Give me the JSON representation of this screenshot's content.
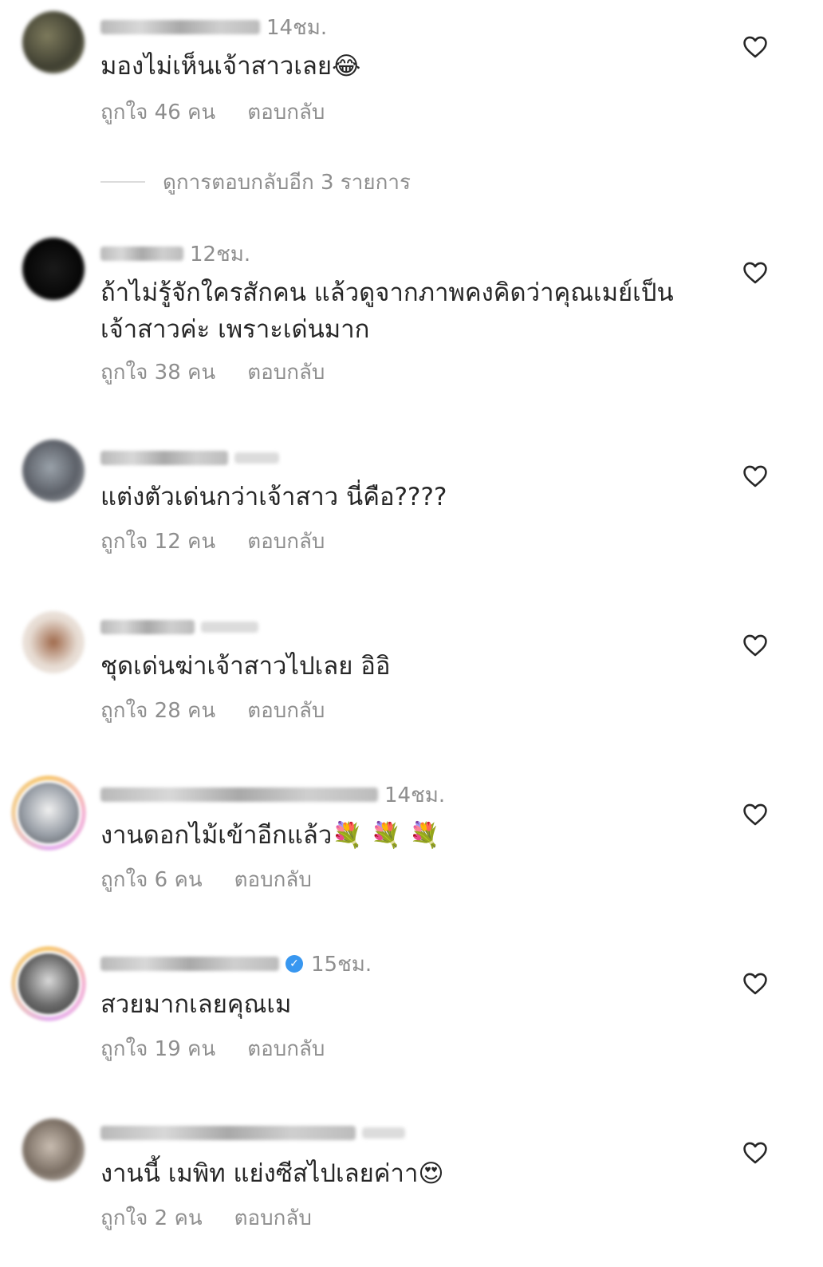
{
  "comments": [
    {
      "time": "14ชม.",
      "text": "มองไม่เห็นเจ้าสาวเลย😂",
      "likes": "ถูกใจ 46 คน",
      "reply": "ตอบกลับ",
      "avatar_color": "#5a5a48"
    },
    {
      "time": "12ชม.",
      "text": "ถ้าไม่รู้จักใครสักคน แล้วดูจากภาพคงคิดว่าคุณเมย์เป็น เจ้าสาวค่ะ เพราะเด่นมาก",
      "likes": "ถูกใจ 38 คน",
      "reply": "ตอบกลับ",
      "avatar_color": "#0a0a0a"
    },
    {
      "time": "",
      "text": "แต่งตัวเด่นกว่าเจ้าสาว นี่คือ????",
      "likes": "ถูกใจ 12 คน",
      "reply": "ตอบกลับ",
      "avatar_color": "#7b8086"
    },
    {
      "time": "",
      "text": "ชุดเด่นฆ่าเจ้าสาวไปเลย อิอิ",
      "likes": "ถูกใจ 28 คน",
      "reply": "ตอบกลับ",
      "avatar_color": "#c9b3a3"
    },
    {
      "time": "14ชม.",
      "text": "งานดอกไม้เข้าอีกแล้ว💐 💐 💐",
      "likes": "ถูกใจ 6 คน",
      "reply": "ตอบกลับ",
      "avatar_color": "#9aa0a8"
    },
    {
      "time": "15ชม.",
      "text": "สวยมากเลยคุณเม",
      "likes": "ถูกใจ 19 คน",
      "reply": "ตอบกลับ",
      "avatar_color": "#777777"
    },
    {
      "time": "",
      "text": "งานนี้ เมพิท แย่งซีสไปเลยค่าา😍",
      "likes": "ถูกใจ 2 คน",
      "reply": "ตอบกลับ",
      "avatar_color": "#8c8077"
    }
  ],
  "view_more_replies": "ดูการตอบกลับอีก 3 รายการ",
  "colors": {
    "text": "#262626",
    "secondary": "#8e8e8e",
    "verified": "#3897f0",
    "divider": "#dbdbdb"
  },
  "icons": {
    "like": "heart-outline-icon",
    "verified": "verified-badge-icon"
  }
}
